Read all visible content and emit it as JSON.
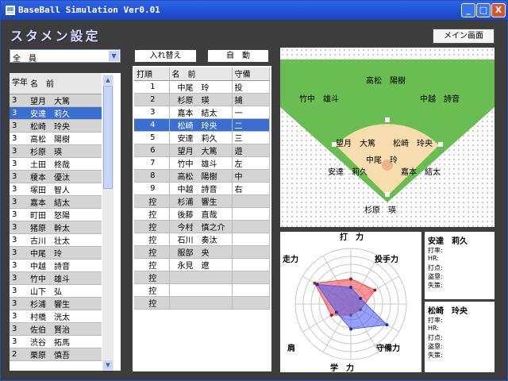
{
  "window": {
    "title": "BaseBall Simulation Ver0.01",
    "minimize": "_",
    "maximize": "□",
    "close": "X"
  },
  "heading": "スタメン設定",
  "main_menu_button": "メイン画面",
  "filter": {
    "selected": "全　員"
  },
  "swap_button": "入れ替え",
  "auto_button": "自　動",
  "roster": {
    "headers": [
      "学年",
      "名　前"
    ],
    "rows": [
      {
        "year": "3",
        "name": "望月　大篤"
      },
      {
        "year": "3",
        "name": "安達　莉久"
      },
      {
        "year": "3",
        "name": "松崎　玲央"
      },
      {
        "year": "3",
        "name": "高松　陽樹"
      },
      {
        "year": "3",
        "name": "杉原　瑛"
      },
      {
        "year": "3",
        "name": "土田　柊哉"
      },
      {
        "year": "3",
        "name": "榎本　優汰"
      },
      {
        "year": "3",
        "name": "塚田　智人"
      },
      {
        "year": "3",
        "name": "嘉本　結太"
      },
      {
        "year": "3",
        "name": "町田　怒陽"
      },
      {
        "year": "3",
        "name": "猪原　幹太"
      },
      {
        "year": "3",
        "name": "古川　壮太"
      },
      {
        "year": "3",
        "name": "中尾　玲"
      },
      {
        "year": "3",
        "name": "中越　詩音"
      },
      {
        "year": "3",
        "name": "竹中　雄斗"
      },
      {
        "year": "3",
        "name": "山下　弘"
      },
      {
        "year": "3",
        "name": "杉浦　響生"
      },
      {
        "year": "3",
        "name": "村橋　洸太"
      },
      {
        "year": "3",
        "name": "佐伯　賢治"
      },
      {
        "year": "3",
        "name": "渋谷　拓馬"
      },
      {
        "year": "2",
        "name": "栗原　慎吾"
      }
    ]
  },
  "lineup": {
    "headers": [
      "打順",
      "名　前",
      "守備"
    ],
    "rows": [
      {
        "order": "1",
        "name": "中尾　玲",
        "pos": "投"
      },
      {
        "order": "2",
        "name": "杉原　瑛",
        "pos": "捕"
      },
      {
        "order": "3",
        "name": "嘉本　結太",
        "pos": "一"
      },
      {
        "order": "4",
        "name": "松崎　玲央",
        "pos": "二"
      },
      {
        "order": "5",
        "name": "安達　莉久",
        "pos": "三"
      },
      {
        "order": "6",
        "name": "望月　大篤",
        "pos": "遊"
      },
      {
        "order": "7",
        "name": "竹中　雄斗",
        "pos": "左"
      },
      {
        "order": "8",
        "name": "高松　陽樹",
        "pos": "中"
      },
      {
        "order": "9",
        "name": "中越　詩音",
        "pos": "右"
      },
      {
        "order": "控",
        "name": "杉浦　響生",
        "pos": ""
      },
      {
        "order": "控",
        "name": "後藤　直哉",
        "pos": ""
      },
      {
        "order": "控",
        "name": "今村　慎之介",
        "pos": ""
      },
      {
        "order": "控",
        "name": "石川　奏汰",
        "pos": ""
      },
      {
        "order": "控",
        "name": "服部　央",
        "pos": ""
      },
      {
        "order": "控",
        "name": "永見　遼",
        "pos": ""
      },
      {
        "order": "控",
        "name": "",
        "pos": ""
      },
      {
        "order": "控",
        "name": "",
        "pos": ""
      },
      {
        "order": "控",
        "name": "",
        "pos": ""
      }
    ]
  },
  "field_labels": {
    "cf": "高松　陽樹",
    "lf": "竹中　雄斗",
    "rf": "中越　詩音",
    "ss": "望月　大篤",
    "b2": "松崎　玲央",
    "p": "中尾　玲",
    "b3": "安達　莉久",
    "b1": "嘉本　結太",
    "c": "杉原　瑛"
  },
  "radar": {
    "axes": [
      "打　力",
      "投手力",
      "守備力",
      "学　力",
      "肩",
      "走力"
    ],
    "series": [
      {
        "values": [
          0.45,
          0.5,
          0.2,
          0.2,
          0.4,
          0.75
        ],
        "color": "#f05050"
      },
      {
        "values": [
          0.3,
          0.2,
          0.75,
          0.45,
          0.3,
          0.7
        ],
        "color": "#5060f0"
      }
    ]
  },
  "card1": {
    "name": "安達　莉久",
    "labels": [
      "打率:",
      "HR:",
      "打点:",
      "盗塁:",
      "失策:"
    ]
  },
  "card2": {
    "name": "松崎　玲央",
    "labels": [
      "打率:",
      "HR:",
      "打点:",
      "盗塁:",
      "失策:"
    ]
  }
}
